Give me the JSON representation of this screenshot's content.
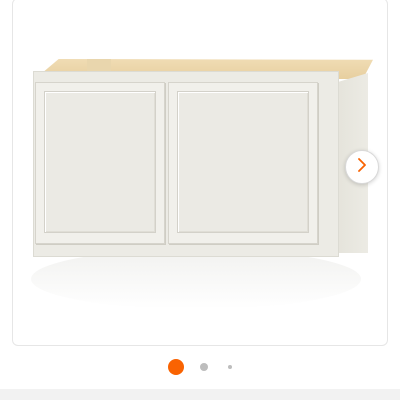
{
  "gallery": {
    "image_alt": "",
    "next_button_icon": "chevron-right-icon",
    "active_dot_color": "#f96302",
    "inactive_dot_color": "#bdbdbd",
    "slide_count_visible": 3,
    "active_slide": 1
  }
}
